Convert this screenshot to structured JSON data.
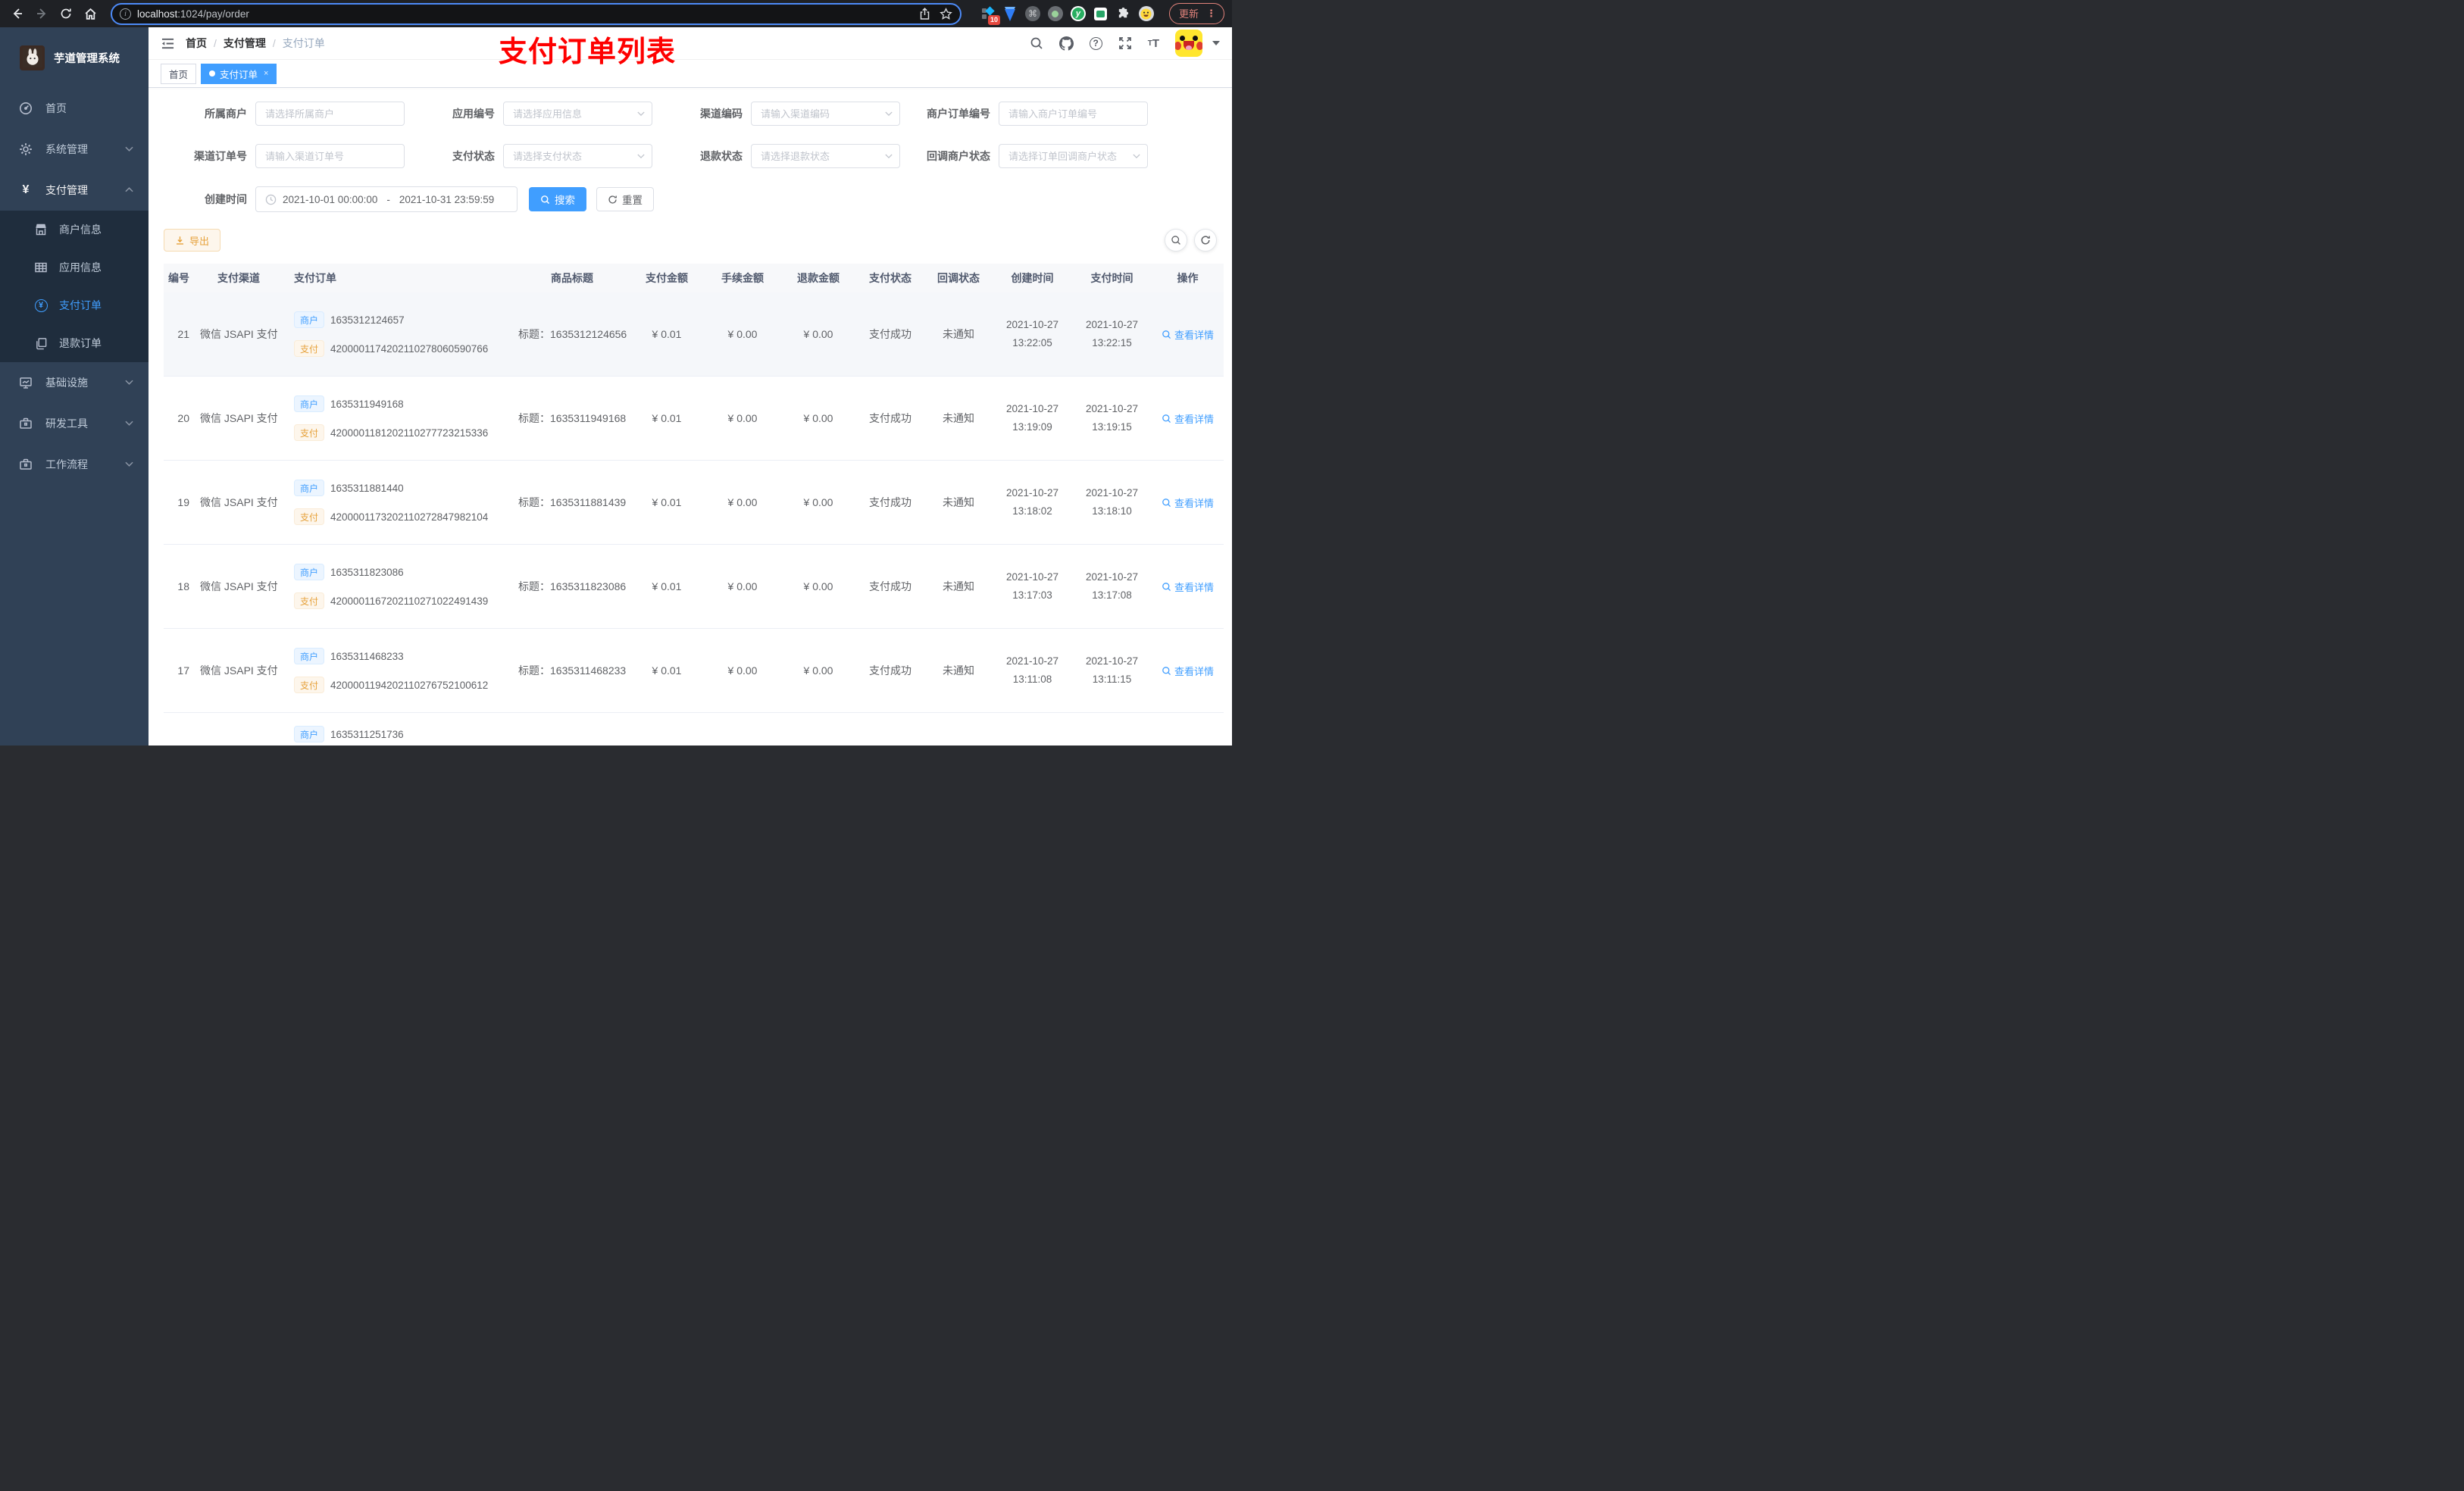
{
  "icons": {
    "yen": "¥",
    "command": "⌘",
    "question": "?",
    "font_size_small": "T",
    "font_size_big": "T",
    "dots": "⋮",
    "close": "×",
    "info": "i",
    "y_letter": "y"
  },
  "browser": {
    "url_host": "localhost",
    "url_path": ":1024/pay/order",
    "extension_badge": "10",
    "update_label": "更新"
  },
  "sidebar": {
    "title": "芋道管理系统",
    "items": [
      {
        "label": "首页"
      },
      {
        "label": "系统管理"
      },
      {
        "label": "支付管理"
      },
      {
        "label": "基础设施"
      },
      {
        "label": "研发工具"
      },
      {
        "label": "工作流程"
      }
    ],
    "sub_items": [
      {
        "label": "商户信息"
      },
      {
        "label": "应用信息"
      },
      {
        "label": "支付订单"
      },
      {
        "label": "退款订单"
      }
    ]
  },
  "breadcrumb": {
    "items": [
      "首页",
      "支付管理",
      "支付订单"
    ],
    "separator": "/"
  },
  "overlay_title": "支付订单列表",
  "tabs": [
    {
      "label": "首页"
    },
    {
      "label": "支付订单"
    }
  ],
  "filters": {
    "fields": [
      {
        "label": "所属商户",
        "placeholder": "请选择所属商户",
        "type": "input"
      },
      {
        "label": "应用编号",
        "placeholder": "请选择应用信息",
        "type": "select"
      },
      {
        "label": "渠道编码",
        "placeholder": "请输入渠道编码",
        "type": "select"
      },
      {
        "label": "商户订单编号",
        "placeholder": "请输入商户订单编号",
        "type": "input"
      },
      {
        "label": "渠道订单号",
        "placeholder": "请输入渠道订单号",
        "type": "input"
      },
      {
        "label": "支付状态",
        "placeholder": "请选择支付状态",
        "type": "select"
      },
      {
        "label": "退款状态",
        "placeholder": "请选择退款状态",
        "type": "select"
      },
      {
        "label": "回调商户状态",
        "placeholder": "请选择订单回调商户状态",
        "type": "select"
      }
    ],
    "date_label": "创建时间",
    "date_start": "2021-10-01 00:00:00",
    "date_separator": "-",
    "date_end": "2021-10-31 23:59:59",
    "search_label": "搜索",
    "reset_label": "重置"
  },
  "toolbar": {
    "export_label": "导出"
  },
  "table": {
    "columns": [
      "编号",
      "支付渠道",
      "支付订单",
      "商品标题",
      "支付金额",
      "手续金额",
      "退款金额",
      "支付状态",
      "回调状态",
      "创建时间",
      "支付时间",
      "操作"
    ],
    "tag_merchant": "商户",
    "tag_pay": "支付",
    "action_label": "查看详情",
    "rows": [
      {
        "id": "21",
        "channel": "微信 JSAPI 支付",
        "merchant_no": "1635312124657",
        "pay_no": "4200001174202110278060590766",
        "title": "标题：1635312124656",
        "amount": "¥ 0.01",
        "fee": "¥ 0.00",
        "refund": "¥ 0.00",
        "pay_status": "支付成功",
        "notify_status": "未通知",
        "create_date": "2021-10-27",
        "create_time": "13:22:05",
        "pay_date": "2021-10-27",
        "pay_time": "13:22:15",
        "hover": true
      },
      {
        "id": "20",
        "channel": "微信 JSAPI 支付",
        "merchant_no": "1635311949168",
        "pay_no": "4200001181202110277723215336",
        "title": "标题：1635311949168",
        "amount": "¥ 0.01",
        "fee": "¥ 0.00",
        "refund": "¥ 0.00",
        "pay_status": "支付成功",
        "notify_status": "未通知",
        "create_date": "2021-10-27",
        "create_time": "13:19:09",
        "pay_date": "2021-10-27",
        "pay_time": "13:19:15",
        "hover": false
      },
      {
        "id": "19",
        "channel": "微信 JSAPI 支付",
        "merchant_no": "1635311881440",
        "pay_no": "4200001173202110272847982104",
        "title": "标题：1635311881439",
        "amount": "¥ 0.01",
        "fee": "¥ 0.00",
        "refund": "¥ 0.00",
        "pay_status": "支付成功",
        "notify_status": "未通知",
        "create_date": "2021-10-27",
        "create_time": "13:18:02",
        "pay_date": "2021-10-27",
        "pay_time": "13:18:10",
        "hover": false
      },
      {
        "id": "18",
        "channel": "微信 JSAPI 支付",
        "merchant_no": "1635311823086",
        "pay_no": "4200001167202110271022491439",
        "title": "标题：1635311823086",
        "amount": "¥ 0.01",
        "fee": "¥ 0.00",
        "refund": "¥ 0.00",
        "pay_status": "支付成功",
        "notify_status": "未通知",
        "create_date": "2021-10-27",
        "create_time": "13:17:03",
        "pay_date": "2021-10-27",
        "pay_time": "13:17:08",
        "hover": false
      },
      {
        "id": "17",
        "channel": "微信 JSAPI 支付",
        "merchant_no": "1635311468233",
        "pay_no": "4200001194202110276752100612",
        "title": "标题：1635311468233",
        "amount": "¥ 0.01",
        "fee": "¥ 0.00",
        "refund": "¥ 0.00",
        "pay_status": "支付成功",
        "notify_status": "未通知",
        "create_date": "2021-10-27",
        "create_time": "13:11:08",
        "pay_date": "2021-10-27",
        "pay_time": "13:11:15",
        "hover": false
      }
    ],
    "partial_row": {
      "merchant_no": "1635311251736"
    }
  }
}
